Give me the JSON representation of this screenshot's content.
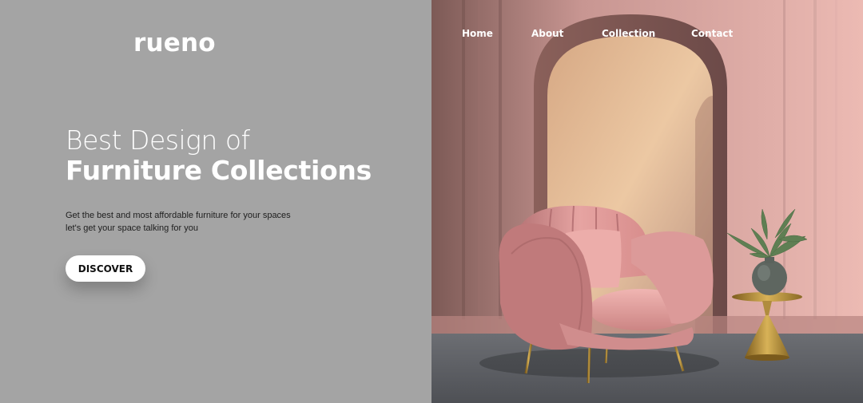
{
  "brand": {
    "logo_text": "rueno"
  },
  "nav": {
    "items": [
      {
        "label": "Home"
      },
      {
        "label": "About"
      },
      {
        "label": "Collection"
      },
      {
        "label": "Contact"
      }
    ]
  },
  "hero": {
    "headline_line1": "Best Design of",
    "headline_line2": "Furniture Collections",
    "tagline_line1": "Get the best and most affordable furniture for your spaces",
    "tagline_line2": "let's get your space talking for you",
    "cta_label": "DISCOVER"
  },
  "image": {
    "description_icon": "pink-armchair-arch-room-image"
  },
  "colors": {
    "left_bg": "#a4a4a4",
    "wall_pink": "#dca8a2",
    "chair_pink": "#e19e9c",
    "floor_gray": "#5a5c61",
    "accent_gold": "#b8923a"
  }
}
